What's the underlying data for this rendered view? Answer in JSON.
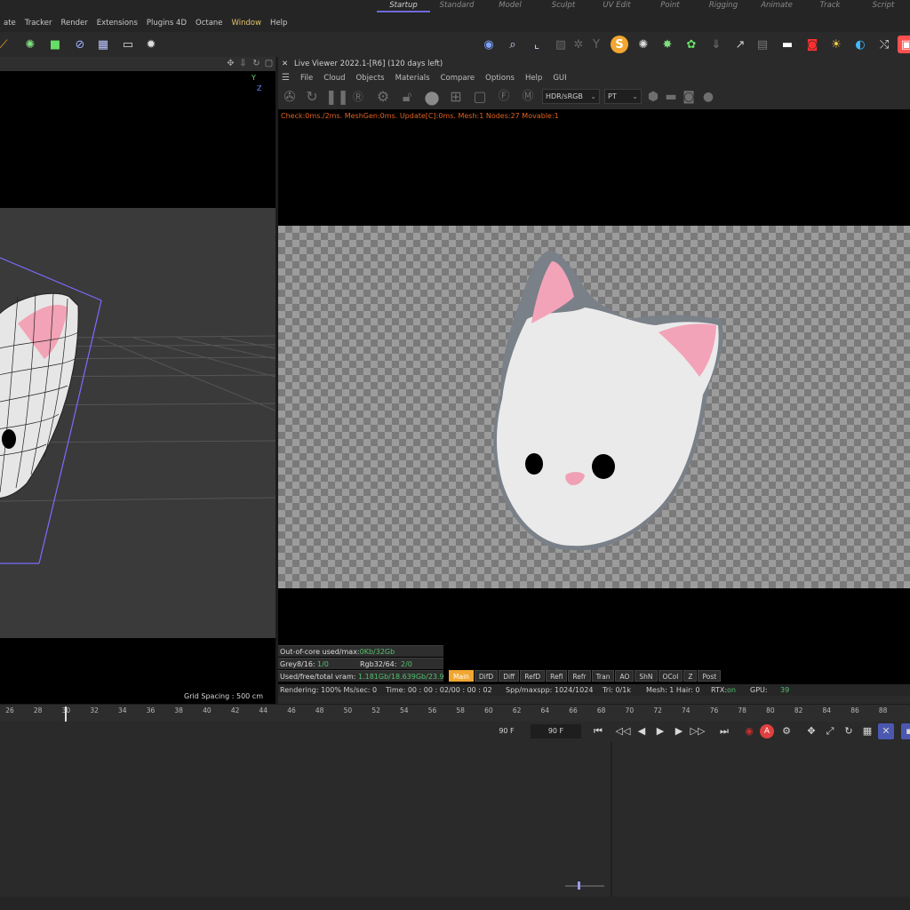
{
  "menu": {
    "items": [
      "ate",
      "Tracker",
      "Render",
      "Extensions",
      "Plugins 4D",
      "Octane",
      "Window",
      "Help"
    ],
    "highlighted": "Window"
  },
  "layouts": {
    "tabs": [
      "Startup",
      "Standard",
      "Model",
      "Sculpt",
      "UV Edit",
      "Point",
      "Rigging",
      "Animate",
      "Track",
      "Script"
    ],
    "active": "Startup"
  },
  "viewport": {
    "grid_spacing": "Grid Spacing : 500 cm",
    "axis_labels": [
      "Y",
      "Z"
    ]
  },
  "live_viewer": {
    "title": "Live Viewer 2022.1-[R6] (120 days left)",
    "menu": [
      "File",
      "Cloud",
      "Objects",
      "Materials",
      "Compare",
      "Options",
      "Help",
      "GUI"
    ],
    "color_space": "HDR/sRGB",
    "kernel": "PT",
    "check_line": "Check:0ms./2ms. MeshGen:0ms. Update[C]:0ms. Mesh:1 Nodes:27 Movable:1",
    "out_of_core_label": "Out-of-core used/max:",
    "out_of_core_value": "0Kb/32Gb",
    "grey_label": "Grey8/16:",
    "grey_value": "1/0",
    "rgb_label": "Rgb32/64:",
    "rgb_value": "2/0",
    "vram_label": "Used/free/total vram:",
    "vram_value": "1.181Gb/18.639Gb/23.9",
    "passes": [
      "Main",
      "DifD",
      "Diff",
      "RefD",
      "Refl",
      "Refr",
      "Tran",
      "AO",
      "ShN",
      "OCol",
      "Z",
      "Post"
    ],
    "active_pass": "Main",
    "render_status": {
      "rendering": "Rendering: 100% Ms/sec: 0",
      "time": "Time: 00 : 00 : 02/00 : 00 : 02",
      "spp_label": "Spp/maxspp:",
      "spp_value": "1024/1024",
      "tri": "Tri: 0/1k",
      "mesh": "Mesh: 1  Hair: 0",
      "rtx_label": "RTX:",
      "rtx_value": "on",
      "gpu_label": "GPU:",
      "gpu_value": "39"
    }
  },
  "timeline": {
    "ticks": [
      "26",
      "28",
      "30",
      "32",
      "34",
      "36",
      "38",
      "40",
      "42",
      "44",
      "46",
      "48",
      "50",
      "52",
      "54",
      "56",
      "58",
      "60",
      "62",
      "64",
      "66",
      "68",
      "70",
      "72",
      "74",
      "76",
      "78",
      "80",
      "82",
      "84",
      "86",
      "88"
    ],
    "current_frame": "30"
  },
  "transport": {
    "end_frame_a": "90 F",
    "end_frame_b": "90 F"
  },
  "colors": {
    "accent": "#6f6ad8",
    "pass_active": "#f0a630",
    "check_text": "#e0611e",
    "value_green": "#53c06a",
    "menu_highlight": "#e3c26a"
  }
}
